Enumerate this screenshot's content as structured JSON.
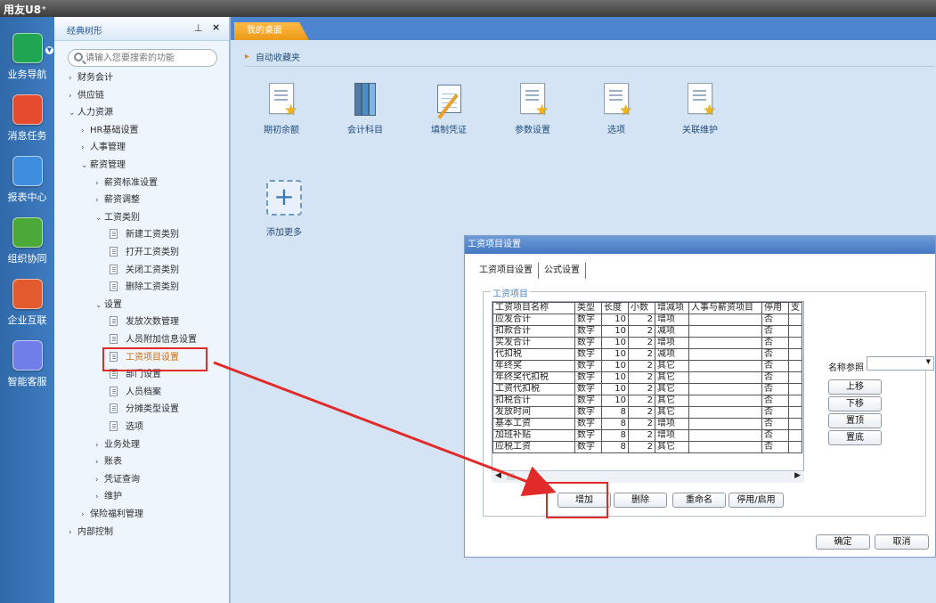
{
  "app": {
    "brand": "用友U8⁺"
  },
  "left_nav": [
    {
      "label": "业务导航",
      "icon": "business-navigation-icon",
      "color": "#20a653"
    },
    {
      "label": "消息任务",
      "icon": "message-task-icon",
      "color": "#e64b2f"
    },
    {
      "label": "报表中心",
      "icon": "report-center-icon",
      "color": "#3e8edf"
    },
    {
      "label": "组织协同",
      "icon": "organization-collaboration-icon",
      "color": "#4aa937"
    },
    {
      "label": "企业互联",
      "icon": "enterprise-connect-icon",
      "color": "#e35a2f"
    },
    {
      "label": "智能客服",
      "icon": "smart-service-icon",
      "color": "#6f7ee8"
    }
  ],
  "tree": {
    "title": "经典树形",
    "search_placeholder": "请输入您要搜索的功能",
    "items": [
      "财务会计",
      "供应链",
      "人力资源",
      "HR基础设置",
      "人事管理",
      "薪资管理",
      "薪资标准设置",
      "薪资调整",
      "工资类别",
      "新建工资类别",
      "打开工资类别",
      "关闭工资类别",
      "删除工资类别",
      "设置",
      "发放次数管理",
      "人员附加信息设置",
      "工资项目设置",
      "部门设置",
      "人员档案",
      "分摊类型设置",
      "选项",
      "业务处理",
      "账表",
      "凭证查询",
      "维护",
      "保险福利管理",
      "内部控制"
    ]
  },
  "workspace": {
    "tab": "我的桌面",
    "favorites_title": "自动收藏夹",
    "shortcuts": [
      "期初余额",
      "会计科目",
      "填制凭证",
      "参数设置",
      "选项",
      "关联维护"
    ],
    "add_more": "添加更多"
  },
  "dialog": {
    "title": "工资项目设置",
    "tabs": [
      "工资项目设置",
      "公式设置"
    ],
    "group_title": "工资项目",
    "columns": [
      "工资项目名称",
      "类型",
      "长度",
      "小数",
      "增减项",
      "人事与薪资项目",
      "停用",
      "支"
    ],
    "rows": [
      [
        "应发合计",
        "数字",
        "10",
        "2",
        "增项",
        "",
        "否",
        ""
      ],
      [
        "扣款合计",
        "数字",
        "10",
        "2",
        "减项",
        "",
        "否",
        ""
      ],
      [
        "实发合计",
        "数字",
        "10",
        "2",
        "增项",
        "",
        "否",
        ""
      ],
      [
        "代扣税",
        "数字",
        "10",
        "2",
        "减项",
        "",
        "否",
        ""
      ],
      [
        "年终奖",
        "数字",
        "10",
        "2",
        "其它",
        "",
        "否",
        ""
      ],
      [
        "年终奖代扣税",
        "数字",
        "10",
        "2",
        "其它",
        "",
        "否",
        ""
      ],
      [
        "工资代扣税",
        "数字",
        "10",
        "2",
        "其它",
        "",
        "否",
        ""
      ],
      [
        "扣税合计",
        "数字",
        "10",
        "2",
        "其它",
        "",
        "否",
        ""
      ],
      [
        "发放时间",
        "数字",
        "8",
        "2",
        "其它",
        "",
        "否",
        ""
      ],
      [
        "基本工资",
        "数字",
        "8",
        "2",
        "增项",
        "",
        "否",
        ""
      ],
      [
        "加班补贴",
        "数字",
        "8",
        "2",
        "增项",
        "",
        "否",
        ""
      ],
      [
        "应税工资",
        "数字",
        "8",
        "2",
        "其它",
        "",
        "否",
        ""
      ]
    ],
    "name_reference": "名称参照",
    "side_buttons": [
      "上移",
      "下移",
      "置顶",
      "置底"
    ],
    "bottom_buttons": [
      "增加",
      "删除",
      "重命名",
      "停用/启用"
    ],
    "ok": "确定",
    "cancel": "取消"
  },
  "colors": {
    "highlight": "#e12a2a",
    "selected_text": "#d36a00"
  }
}
